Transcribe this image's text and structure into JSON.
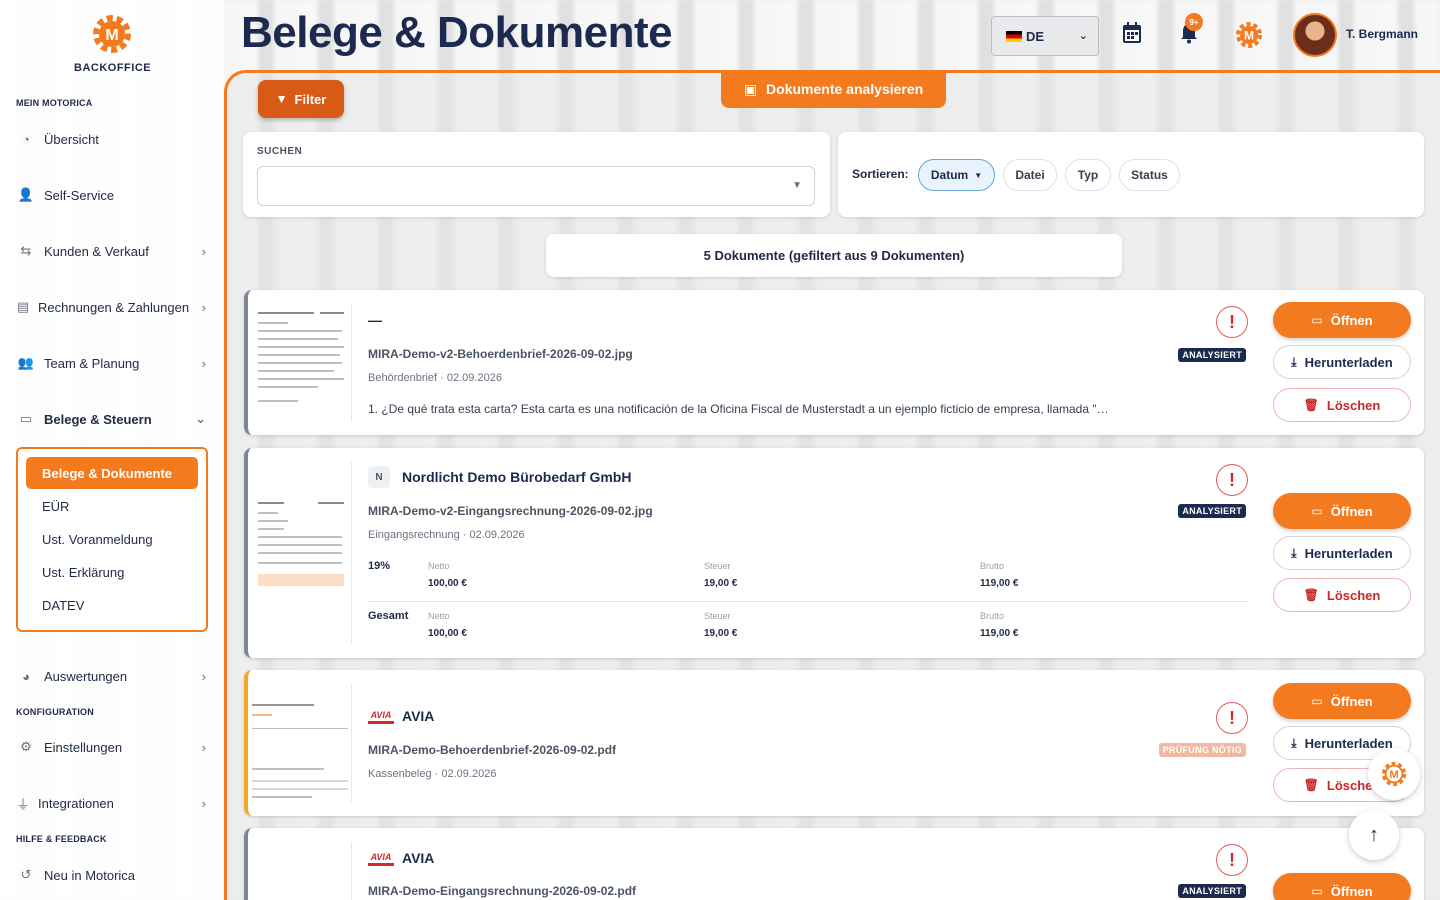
{
  "brand": {
    "name": "BACKOFFICE",
    "accent": "#f47a1f",
    "navy": "#1b2a4e"
  },
  "sidebar": {
    "section_mein": "MEIN MOTORICA",
    "section_konfig": "KONFIGURATION",
    "section_hilfe": "HILFE & FEEDBACK",
    "items": [
      {
        "label": "Übersicht",
        "icon": "dashboard-icon"
      },
      {
        "label": "Self-Service",
        "icon": "user-gear-icon"
      },
      {
        "label": "Kunden & Verkauf",
        "icon": "handshake-icon"
      },
      {
        "label": "Rechnungen & Zahlungen",
        "icon": "invoice-icon"
      },
      {
        "label": "Team & Planung",
        "icon": "users-icon"
      },
      {
        "label": "Belege & Steuern",
        "icon": "folder-open-icon"
      },
      {
        "label": "Auswertungen",
        "icon": "chart-pie-icon"
      },
      {
        "label": "Einstellungen",
        "icon": "gear-icon"
      },
      {
        "label": "Integrationen",
        "icon": "plug-icon"
      },
      {
        "label": "Neu in Motorica",
        "icon": "history-icon"
      }
    ],
    "submenu": [
      "Belege & Dokumente",
      "EÜR",
      "Ust. Voranmeldung",
      "Ust. Erklärung",
      "DATEV"
    ]
  },
  "header": {
    "title": "Belege & Dokumente",
    "language": "DE",
    "notification_badge": "9+",
    "user_name": "T. Bergmann"
  },
  "toolbar": {
    "filter_label": "Filter",
    "analyze_label": "Dokumente analysieren",
    "search_label": "SUCHEN",
    "sort_label": "Sortieren:",
    "sort_options": [
      "Datum",
      "Datei",
      "Typ",
      "Status"
    ],
    "sort_active_arrow": "▼",
    "count_text": "5 Dokumente (gefiltert aus 9 Dokumenten)"
  },
  "actions": {
    "open": "Öffnen",
    "download": "Herunterladen",
    "delete": "Löschen"
  },
  "documents": [
    {
      "title": "—",
      "file": "MIRA-Demo-v2-Behoerdenbrief-2026-09-02.jpg",
      "meta": "Behördenbrief · 02.09.2026",
      "desc": "1. ¿De qué trata esta carta? Esta carta es una notificación de la Oficina Fiscal de Musterstadt a un ejemplo ficticio de empresa, llamada \"…",
      "status": "ANALYSIERT"
    },
    {
      "initial": "N",
      "title": "Nordlicht Demo Bürobedarf GmbH",
      "file": "MIRA-Demo-v2-Eingangsrechnung-2026-09-02.jpg",
      "meta": "Eingangsrechnung · 02.09.2026",
      "status": "ANALYSIERT",
      "tax": {
        "rate_label": "19%",
        "total_label": "Gesamt",
        "head_net": "Netto",
        "head_tax": "Steuer",
        "head_gross": "Brutto",
        "row_net": "100,00 €",
        "row_tax": "19,00 €",
        "row_gross": "119,00 €",
        "total_net": "100,00 €",
        "total_tax": "19,00 €",
        "total_gross": "119,00 €"
      }
    },
    {
      "logo": "AVIA",
      "title": "AVIA",
      "file": "MIRA-Demo-Behoerdenbrief-2026-09-02.pdf",
      "meta": "Kassenbeleg · 02.09.2026",
      "status": "PRÜFUNG NÖTIG"
    },
    {
      "logo": "AVIA",
      "title": "AVIA",
      "file": "MIRA-Demo-Eingangsrechnung-2026-09-02.pdf",
      "status": "ANALYSIERT"
    }
  ]
}
